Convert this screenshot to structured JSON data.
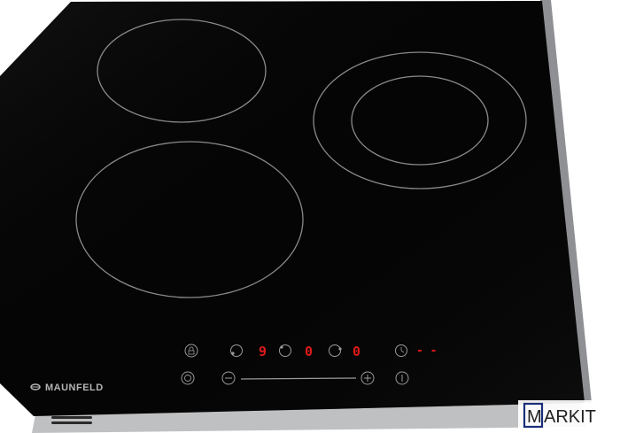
{
  "brand": {
    "name": "MAUNFELD",
    "icon": "maunfeld-logo-icon"
  },
  "watermark": {
    "boxed_letter": "M",
    "rest": "ARKIT"
  },
  "colors": {
    "glass": "#050505",
    "ring_line": "#8a8a8a",
    "control_line": "#9a9a9a",
    "display_red": "#e11a1a",
    "frame_metal": "#c9cacc"
  },
  "controls": {
    "top_row": [
      {
        "name": "lock-button",
        "icon": "lock-icon"
      },
      {
        "name": "zone-left-button",
        "icon": "zone-icon"
      },
      {
        "name": "zone-left-display",
        "value": "9"
      },
      {
        "name": "zone-center-button",
        "icon": "zone-icon"
      },
      {
        "name": "zone-center-display",
        "value": "0"
      },
      {
        "name": "zone-right-button",
        "icon": "zone-icon"
      },
      {
        "name": "zone-right-display",
        "value": "0"
      },
      {
        "name": "timer-button",
        "icon": "clock-icon"
      },
      {
        "name": "timer-display",
        "value": "- -"
      }
    ],
    "bottom_row": [
      {
        "name": "power-button",
        "icon": "power-icon"
      },
      {
        "name": "minus-button",
        "icon": "minus-icon"
      },
      {
        "name": "slider",
        "icon": "slider-track"
      },
      {
        "name": "plus-button",
        "icon": "plus-icon"
      },
      {
        "name": "info-button",
        "icon": "info-icon"
      }
    ],
    "displays": {
      "left": "9",
      "center": "0",
      "right": "0",
      "timer": "- -"
    }
  }
}
